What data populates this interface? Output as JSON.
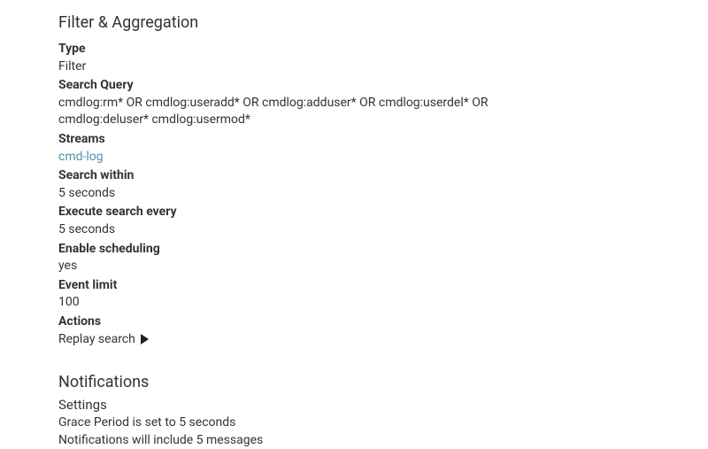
{
  "filter_section": {
    "heading": "Filter & Aggregation",
    "type_label": "Type",
    "type_value": "Filter",
    "search_query_label": "Search Query",
    "search_query_value": "cmdlog:rm* OR cmdlog:useradd* OR cmdlog:adduser* OR cmdlog:userdel* OR cmdlog:deluser* cmdlog:usermod*",
    "streams_label": "Streams",
    "streams_link": "cmd-log",
    "search_within_label": "Search within",
    "search_within_value": "5 seconds",
    "execute_every_label": "Execute search every",
    "execute_every_value": "5 seconds",
    "enable_scheduling_label": "Enable scheduling",
    "enable_scheduling_value": "yes",
    "event_limit_label": "Event limit",
    "event_limit_value": "100",
    "actions_label": "Actions",
    "replay_search_label": "Replay search"
  },
  "notifications_section": {
    "heading": "Notifications",
    "settings_heading": "Settings",
    "grace_period": "Grace Period is set to 5 seconds",
    "include_messages": "Notifications will include 5 messages"
  }
}
